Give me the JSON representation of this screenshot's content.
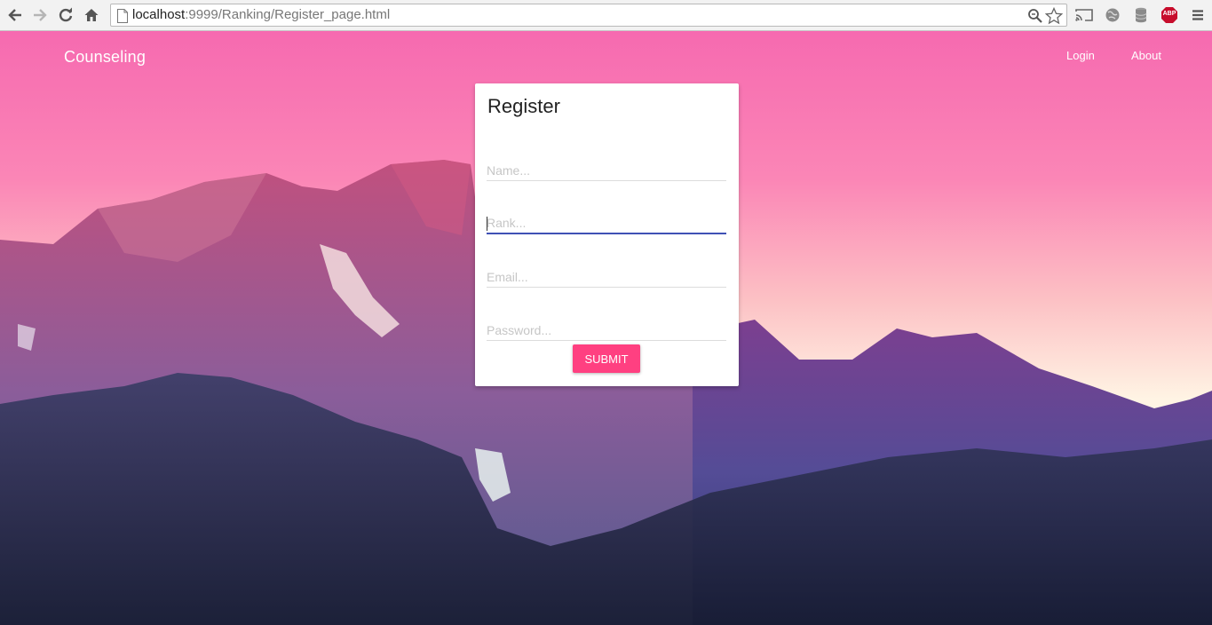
{
  "browser": {
    "url_host": "localhost",
    "url_path": ":9999/Ranking/Register_page.html",
    "icons": {
      "back": "arrow-left-icon",
      "forward": "arrow-right-icon",
      "reload": "reload-icon",
      "home": "home-icon",
      "page": "page-icon",
      "zoom": "magnifier-icon",
      "bookmark": "star-icon",
      "cast": "cast-icon",
      "globe": "globe-icon",
      "database": "database-icon",
      "adblock": "abp-icon",
      "menu": "hamburger-menu-icon"
    },
    "adblock_label": "ABP",
    "adblock_color": "#c70d2c"
  },
  "navbar": {
    "brand": "Counseling",
    "links": [
      "Login",
      "About"
    ]
  },
  "register": {
    "title": "Register",
    "fields": {
      "name": {
        "placeholder": "Name...",
        "value": ""
      },
      "rank": {
        "placeholder": "Rank...",
        "value": "",
        "focused": true
      },
      "email": {
        "placeholder": "Email...",
        "value": ""
      },
      "password": {
        "placeholder": "Password...",
        "value": ""
      }
    },
    "submit_label": "SUBMIT"
  },
  "colors": {
    "accent": "#ff4081",
    "focus_underline": "#3f51b5",
    "sky_top": "#f66ab0",
    "sky_bottom": "#fff4e4"
  }
}
